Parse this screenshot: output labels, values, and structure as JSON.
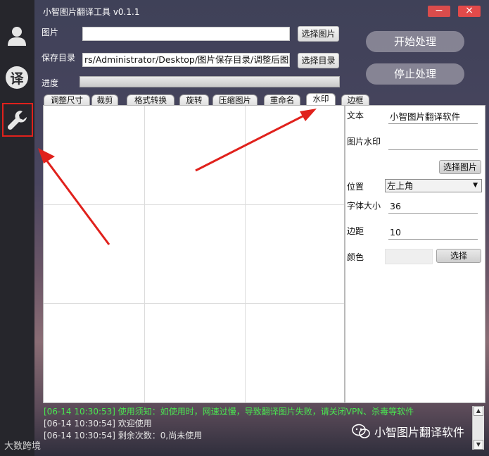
{
  "app": {
    "title": "小智图片翻译工具 v0.1.1",
    "minimize_glyph": "−",
    "close_glyph": "×"
  },
  "sidebar": {
    "items": [
      {
        "name": "user-icon"
      },
      {
        "name": "translate-icon",
        "label": "译"
      },
      {
        "name": "wrench-icon"
      }
    ]
  },
  "top": {
    "image_label": "图片",
    "image_value": "",
    "choose_image": "选择图片",
    "save_dir_label": "保存目录",
    "save_dir_value": "rs/Administrator/Desktop/图片保存目录/调整后图片",
    "choose_dir": "选择目录",
    "progress_label": "进度",
    "progress_value": 0,
    "start": "开始处理",
    "stop": "停止处理"
  },
  "tabs": [
    "调整尺寸",
    "裁剪",
    "格式转换",
    "旋转",
    "压缩图片",
    "重命名",
    "水印",
    "边框"
  ],
  "active_tab": "水印",
  "watermark": {
    "text_label": "文本",
    "text_value": "小智图片翻译软件",
    "image_label": "图片水印",
    "image_value": "",
    "choose_image": "选择图片",
    "position_label": "位置",
    "position_value": "左上角",
    "font_size_label": "字体大小",
    "font_size_value": "36",
    "margin_label": "边距",
    "margin_value": "10",
    "color_label": "颜色",
    "color_choose": "选择"
  },
  "log": [
    {
      "text": "[06-14 10:30:53] 使用须知：如使用时，网速过慢，导致翻译图片失败，请关闭VPN、杀毒等软件",
      "color": "#49e650"
    },
    {
      "text": "[06-14 10:30:54] 欢迎使用",
      "color": "#e2e2e2"
    },
    {
      "text": "[06-14 10:30:54] 剩余次数：0,尚未使用",
      "color": "#e2e2e2"
    }
  ],
  "watermark_overlay": "小智图片翻译软件",
  "bottom_watermark": "大数跨境",
  "colors": {
    "annotation_red": "#e0211c",
    "log_green": "#49e650"
  }
}
